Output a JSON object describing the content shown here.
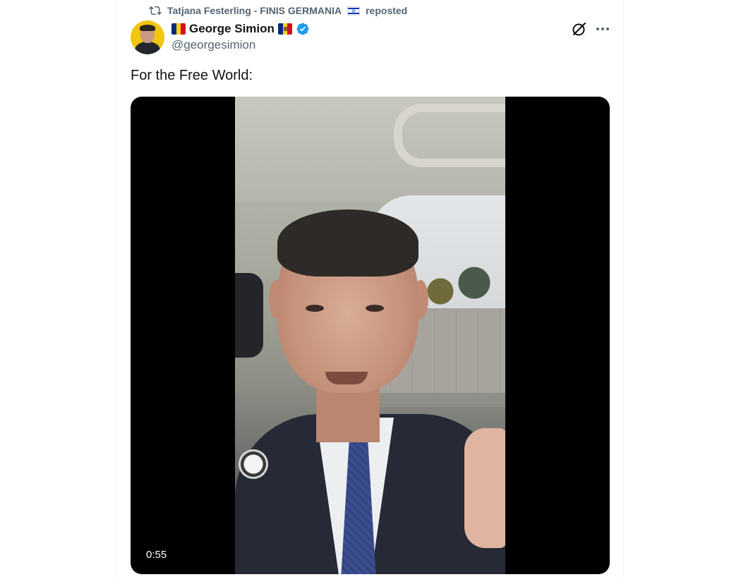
{
  "repost": {
    "icon": "repost-icon",
    "author": "Tatjana Festerling - FINIS GERMANIA",
    "author_flag": "israel-flag",
    "action": "reposted"
  },
  "tweet": {
    "display_name": "George Simion",
    "name_flags": [
      "romania-flag",
      "moldova-flag"
    ],
    "verified": true,
    "handle": "@georgesimion",
    "text": "For the Free World:"
  },
  "media": {
    "type": "video",
    "duration": "0:55"
  },
  "colors": {
    "text_primary": "#0f1419",
    "text_secondary": "#536471",
    "verified_blue": "#1d9bf0",
    "avatar_bg": "#f2c50f"
  }
}
